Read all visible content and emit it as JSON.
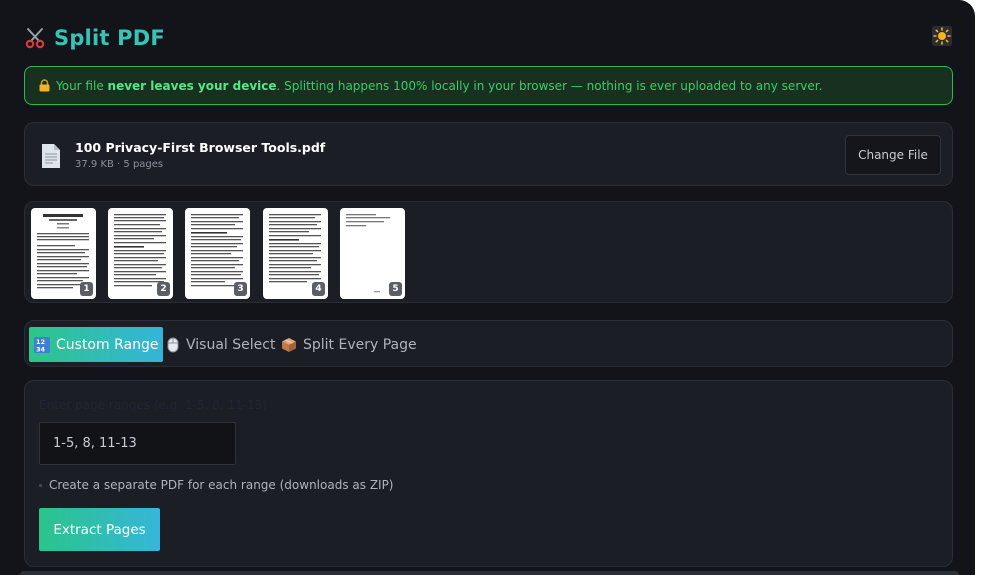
{
  "app": {
    "title": "Split PDF",
    "logo_icon": "scissors-icon",
    "theme_icon": "sun-icon"
  },
  "privacy": {
    "prefix": "Your file ",
    "bold": "never leaves your device",
    "suffix": ". Splitting happens 100% locally in your browser — nothing is ever uploaded to any server."
  },
  "file": {
    "name": "100 Privacy-First Browser Tools.pdf",
    "meta": "37.9 KB · 5 pages",
    "change_label": "Change File"
  },
  "thumbnails": [
    {
      "page": "1"
    },
    {
      "page": "2"
    },
    {
      "page": "3"
    },
    {
      "page": "4"
    },
    {
      "page": "5"
    }
  ],
  "tabs": [
    {
      "label": "Custom Range",
      "icon": "numbers-icon",
      "active": true
    },
    {
      "label": "Visual Select",
      "icon": "mouse-icon",
      "active": false
    },
    {
      "label": "Split Every Page",
      "icon": "package-icon",
      "active": false
    }
  ],
  "form": {
    "range_label": "Enter page ranges (e.g. 1-5, 8, 11-13)",
    "range_placeholder": "1-5, 8, 11-13",
    "separate_label": "Create a separate PDF for each range (downloads as ZIP)",
    "extract_label": "Extract Pages"
  },
  "colors": {
    "background": "#121419",
    "card": "#1b1e25",
    "accent": "#37c4b6",
    "success": "#35d06a",
    "gradient_start": "#2dc58a",
    "gradient_end": "#35b4da"
  }
}
